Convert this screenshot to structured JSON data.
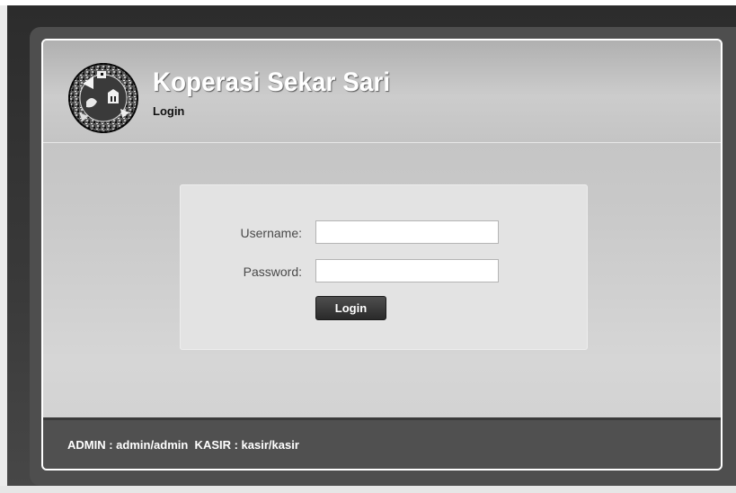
{
  "header": {
    "title": "Koperasi Sekar Sari",
    "subtitle": "Login",
    "logo_icon": "cooperative-emblem-icon"
  },
  "login_form": {
    "username_label": "Username:",
    "username_value": "",
    "password_label": "Password:",
    "password_value": "",
    "submit_label": "Login"
  },
  "footer": {
    "credentials_text": "ADMIN : admin/admin  KASIR : kasir/kasir"
  },
  "colors": {
    "background_dark": "#3a3a3a",
    "panel": "#e3e3e3",
    "footer": "#505050",
    "button": "#333333"
  }
}
